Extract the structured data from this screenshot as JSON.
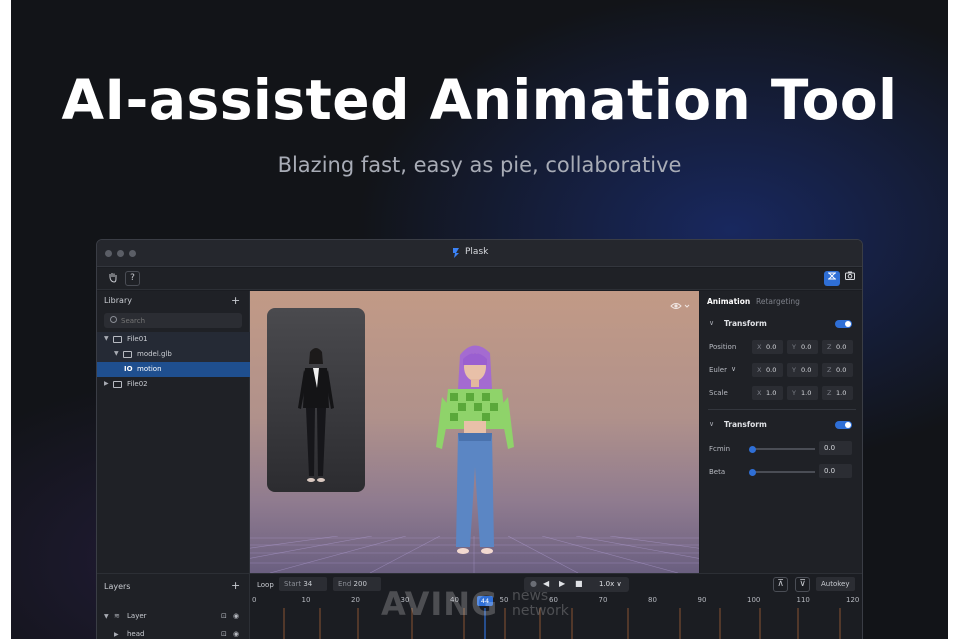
{
  "hero": {
    "title": "AI-assisted Animation Tool",
    "subtitle": "Blazing fast, easy as pie, collaborative"
  },
  "window": {
    "title": "Plask",
    "accent_color": "#2f6fd6"
  },
  "toolbar": {
    "help_label": "?"
  },
  "library": {
    "title": "Library",
    "add_label": "+",
    "search_placeholder": "Search",
    "items": [
      {
        "label": "File01",
        "expanded": true,
        "type": "folder"
      },
      {
        "label": "model.glb",
        "expanded": true,
        "type": "folder"
      },
      {
        "label": "motion",
        "selected": true,
        "type": "motion"
      },
      {
        "label": "File02",
        "expanded": false,
        "type": "folder"
      }
    ]
  },
  "properties": {
    "tabs": [
      {
        "label": "Animation",
        "active": true
      },
      {
        "label": "Retargeting",
        "active": false
      }
    ],
    "transform": {
      "title": "Transform",
      "enabled": true,
      "rows": [
        {
          "label": "Position",
          "x": "0.0",
          "y": "0.0",
          "z": "0.0"
        },
        {
          "label": "Euler",
          "x": "0.0",
          "y": "0.0",
          "z": "0.0"
        },
        {
          "label": "Scale",
          "x": "1.0",
          "y": "1.0",
          "z": "1.0"
        }
      ],
      "axis_labels": {
        "x": "X",
        "y": "Y",
        "z": "Z"
      }
    },
    "filter": {
      "title": "Transform",
      "enabled": true,
      "sliders": [
        {
          "label": "Fcmin",
          "value": "0.0",
          "fraction": 0.0
        },
        {
          "label": "Beta",
          "value": "0.0",
          "fraction": 0.0
        }
      ]
    }
  },
  "layers": {
    "title": "Layers",
    "add_label": "+",
    "rows": [
      {
        "label": "Layer"
      },
      {
        "label": "head"
      }
    ]
  },
  "timeline": {
    "loop_label": "Loop",
    "start_label": "Start",
    "start_value": "34",
    "end_label": "End",
    "end_value": "200",
    "speed": "1.0x",
    "autokey_label": "Autokey",
    "current_frame": "44",
    "ruler": [
      "0",
      "10",
      "20",
      "30",
      "40",
      "50",
      "60",
      "70",
      "80",
      "90",
      "100",
      "110",
      "120"
    ]
  },
  "watermark": {
    "brand": "AVING",
    "line1": "news",
    "line2": "network"
  }
}
